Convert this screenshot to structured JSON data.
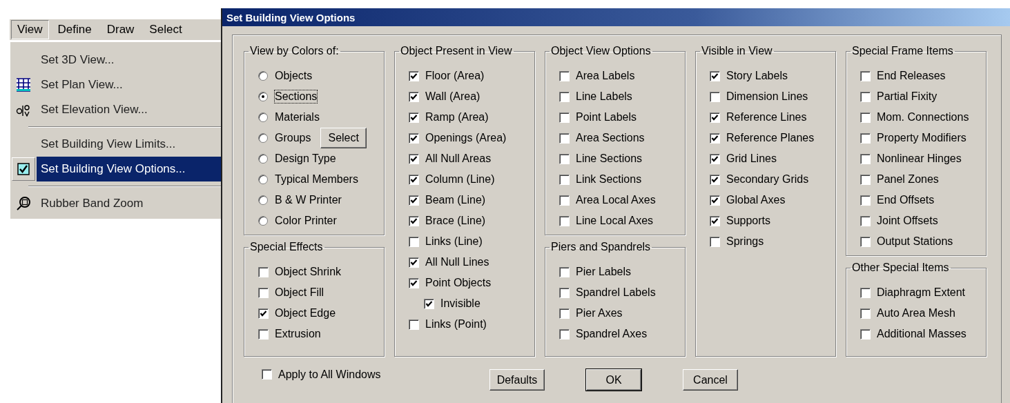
{
  "menu_bar": [
    {
      "label": "View",
      "selected": true
    },
    {
      "label": "Define",
      "selected": false
    },
    {
      "label": "Draw",
      "selected": false
    },
    {
      "label": "Select",
      "selected": false
    }
  ],
  "menu": [
    {
      "kind": "plain",
      "label": "Set 3D View...",
      "selected": false
    },
    {
      "kind": "grid",
      "label": "Set Plan View...",
      "selected": false
    },
    {
      "kind": "elevation",
      "label": "Set Elevation View...",
      "selected": false
    },
    {
      "kind": "separator"
    },
    {
      "kind": "plain",
      "label": "Set Building View Limits...",
      "selected": false
    },
    {
      "kind": "check",
      "label": "Set Building View Options...",
      "selected": true,
      "checked": true
    },
    {
      "kind": "separator"
    },
    {
      "kind": "zoom",
      "label": "Rubber Band Zoom",
      "selected": false
    }
  ],
  "dialog": {
    "title": "Set Building View Options",
    "columns": [
      [
        {
          "title": "View by Colors of:",
          "items": [
            {
              "kind": "radio",
              "label": "Objects",
              "selected": false
            },
            {
              "kind": "radio",
              "label": "Sections",
              "selected": true
            },
            {
              "kind": "radio",
              "label": "Materials",
              "selected": false
            },
            {
              "kind": "radio",
              "label": "Groups",
              "selected": false,
              "button": "Select"
            },
            {
              "kind": "radio",
              "label": "Design Type",
              "selected": false
            },
            {
              "kind": "radio",
              "label": "Typical Members",
              "selected": false
            },
            {
              "kind": "radio",
              "label": "B & W Printer",
              "selected": false
            },
            {
              "kind": "radio",
              "label": "Color Printer",
              "selected": false
            }
          ]
        },
        {
          "title": "Special Effects",
          "items": [
            {
              "kind": "checkbox",
              "label": "Object Shrink",
              "checked": false
            },
            {
              "kind": "checkbox",
              "label": "Object Fill",
              "checked": false
            },
            {
              "kind": "checkbox",
              "label": "Object Edge",
              "checked": true
            },
            {
              "kind": "checkbox",
              "label": "Extrusion",
              "checked": false
            }
          ]
        }
      ],
      [
        {
          "title": "Object Present in View",
          "items": [
            {
              "kind": "checkbox",
              "label": "Floor (Area)",
              "checked": true
            },
            {
              "kind": "checkbox",
              "label": "Wall (Area)",
              "checked": true
            },
            {
              "kind": "checkbox",
              "label": "Ramp (Area)",
              "checked": true
            },
            {
              "kind": "checkbox",
              "label": "Openings (Area)",
              "checked": true
            },
            {
              "kind": "checkbox",
              "label": "All Null Areas",
              "checked": true
            },
            {
              "kind": "checkbox",
              "label": "Column (Line)",
              "checked": true
            },
            {
              "kind": "checkbox",
              "label": "Beam (Line)",
              "checked": true
            },
            {
              "kind": "checkbox",
              "label": "Brace (Line)",
              "checked": true
            },
            {
              "kind": "checkbox",
              "label": "Links (Line)",
              "checked": false
            },
            {
              "kind": "checkbox",
              "label": "All Null Lines",
              "checked": true
            },
            {
              "kind": "checkbox",
              "label": "Point Objects",
              "checked": true,
              "children": [
                {
                  "kind": "checkbox",
                  "label": "Invisible",
                  "checked": true
                }
              ]
            },
            {
              "kind": "checkbox",
              "label": "Links (Point)",
              "checked": false
            }
          ]
        }
      ],
      [
        {
          "title": "Object View Options",
          "items": [
            {
              "kind": "checkbox",
              "label": "Area Labels",
              "checked": false
            },
            {
              "kind": "checkbox",
              "label": "Line Labels",
              "checked": false
            },
            {
              "kind": "checkbox",
              "label": "Point Labels",
              "checked": false
            },
            {
              "kind": "checkbox",
              "label": "Area Sections",
              "checked": false
            },
            {
              "kind": "checkbox",
              "label": "Line Sections",
              "checked": false
            },
            {
              "kind": "checkbox",
              "label": "Link Sections",
              "checked": false
            },
            {
              "kind": "checkbox",
              "label": "Area Local Axes",
              "checked": false
            },
            {
              "kind": "checkbox",
              "label": "Line Local Axes",
              "checked": false
            }
          ]
        },
        {
          "title": "Piers and Spandrels",
          "items": [
            {
              "kind": "checkbox",
              "label": "Pier Labels",
              "checked": false
            },
            {
              "kind": "checkbox",
              "label": "Spandrel Labels",
              "checked": false
            },
            {
              "kind": "checkbox",
              "label": "Pier Axes",
              "checked": false
            },
            {
              "kind": "checkbox",
              "label": "Spandrel Axes",
              "checked": false
            }
          ]
        }
      ],
      [
        {
          "title": "Visible in View",
          "items": [
            {
              "kind": "checkbox",
              "label": "Story Labels",
              "checked": true
            },
            {
              "kind": "checkbox",
              "label": "Dimension Lines",
              "checked": false
            },
            {
              "kind": "checkbox",
              "label": "Reference Lines",
              "checked": true
            },
            {
              "kind": "checkbox",
              "label": "Reference Planes",
              "checked": true
            },
            {
              "kind": "checkbox",
              "label": "Grid Lines",
              "checked": true
            },
            {
              "kind": "checkbox",
              "label": "Secondary Grids",
              "checked": true
            },
            {
              "kind": "checkbox",
              "label": "Global Axes",
              "checked": true
            },
            {
              "kind": "checkbox",
              "label": "Supports",
              "checked": true
            },
            {
              "kind": "checkbox",
              "label": "Springs",
              "checked": false
            }
          ]
        }
      ],
      [
        {
          "title": "Special Frame Items",
          "items": [
            {
              "kind": "checkbox",
              "label": "End Releases",
              "checked": false
            },
            {
              "kind": "checkbox",
              "label": "Partial Fixity",
              "checked": false
            },
            {
              "kind": "checkbox",
              "label": "Mom. Connections",
              "checked": false
            },
            {
              "kind": "checkbox",
              "label": "Property Modifiers",
              "checked": false
            },
            {
              "kind": "checkbox",
              "label": "Nonlinear Hinges",
              "checked": false
            },
            {
              "kind": "checkbox",
              "label": "Panel Zones",
              "checked": false
            },
            {
              "kind": "checkbox",
              "label": "End Offsets",
              "checked": false
            },
            {
              "kind": "checkbox",
              "label": "Joint Offsets",
              "checked": false
            },
            {
              "kind": "checkbox",
              "label": "Output Stations",
              "checked": false
            }
          ]
        },
        {
          "title": "Other Special Items",
          "items": [
            {
              "kind": "checkbox",
              "label": "Diaphragm Extent",
              "checked": false
            },
            {
              "kind": "checkbox",
              "label": "Auto Area Mesh",
              "checked": false
            },
            {
              "kind": "checkbox",
              "label": "Additional Masses",
              "checked": false
            }
          ]
        }
      ]
    ],
    "apply_to_all": {
      "label": "Apply to All Windows",
      "checked": false
    },
    "buttons": [
      {
        "label": "Defaults",
        "default": false
      },
      {
        "label": "OK",
        "default": true
      },
      {
        "label": "Cancel",
        "default": false
      }
    ]
  }
}
